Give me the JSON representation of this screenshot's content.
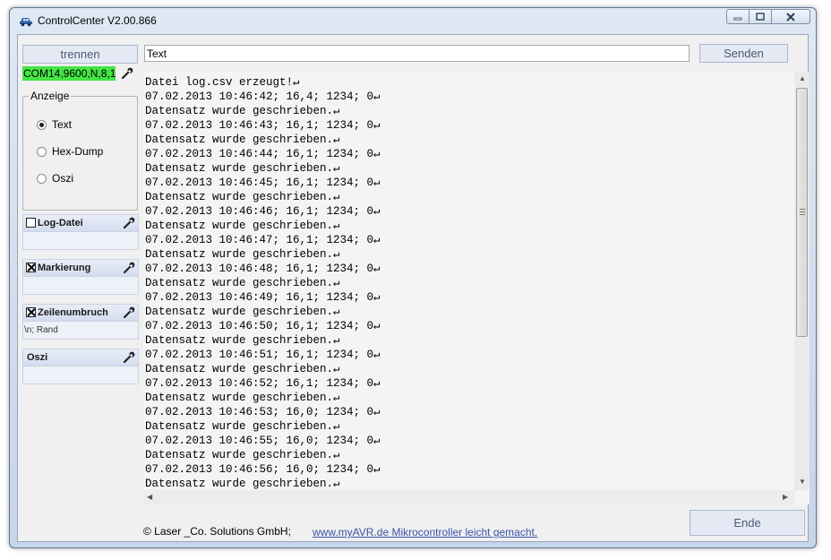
{
  "window": {
    "title": "ControlCenter V2.00.866"
  },
  "connection": {
    "disconnect_label": "trennen",
    "port_settings": "COM14,9600,N,8,1"
  },
  "display_group": {
    "legend": "Anzeige",
    "options": [
      {
        "label": "Text",
        "selected": true
      },
      {
        "label": "Hex-Dump",
        "selected": false
      },
      {
        "label": "Oszi",
        "selected": false
      }
    ]
  },
  "panels": {
    "log": {
      "title": "Log-Datei",
      "checked": false
    },
    "mark": {
      "title": "Markierung",
      "checked": true
    },
    "wrap": {
      "title": "Zeilenumbruch",
      "checked": true,
      "sub": "\\n; Rand"
    },
    "oszi": {
      "title": "Oszi"
    }
  },
  "send": {
    "input_value": "Text",
    "button_label": "Senden"
  },
  "output": {
    "text": "Datei log.csv erzeugt!↵\n07.02.2013 10:46:42; 16,4; 1234; 0↵\nDatensatz wurde geschrieben.↵\n07.02.2013 10:46:43; 16,1; 1234; 0↵\nDatensatz wurde geschrieben.↵\n07.02.2013 10:46:44; 16,1; 1234; 0↵\nDatensatz wurde geschrieben.↵\n07.02.2013 10:46:45; 16,1; 1234; 0↵\nDatensatz wurde geschrieben.↵\n07.02.2013 10:46:46; 16,1; 1234; 0↵\nDatensatz wurde geschrieben.↵\n07.02.2013 10:46:47; 16,1; 1234; 0↵\nDatensatz wurde geschrieben.↵\n07.02.2013 10:46:48; 16,1; 1234; 0↵\nDatensatz wurde geschrieben.↵\n07.02.2013 10:46:49; 16,1; 1234; 0↵\nDatensatz wurde geschrieben.↵\n07.02.2013 10:46:50; 16,1; 1234; 0↵\nDatensatz wurde geschrieben.↵\n07.02.2013 10:46:51; 16,1; 1234; 0↵\nDatensatz wurde geschrieben.↵\n07.02.2013 10:46:52; 16,1; 1234; 0↵\nDatensatz wurde geschrieben.↵\n07.02.2013 10:46:53; 16,0; 1234; 0↵\nDatensatz wurde geschrieben.↵\n07.02.2013 10:46:55; 16,0; 1234; 0↵\nDatensatz wurde geschrieben.↵\n07.02.2013 10:46:56; 16,0; 1234; 0↵\nDatensatz wurde geschrieben.↵"
  },
  "footer": {
    "copyright": "© Laser _Co. Solutions GmbH;",
    "link": "www.myAVR.de Mikrocontroller leicht gemacht.",
    "end_button": "Ende"
  },
  "colors": {
    "port_status_bg": "#44e544",
    "link": "#3c53a5"
  }
}
